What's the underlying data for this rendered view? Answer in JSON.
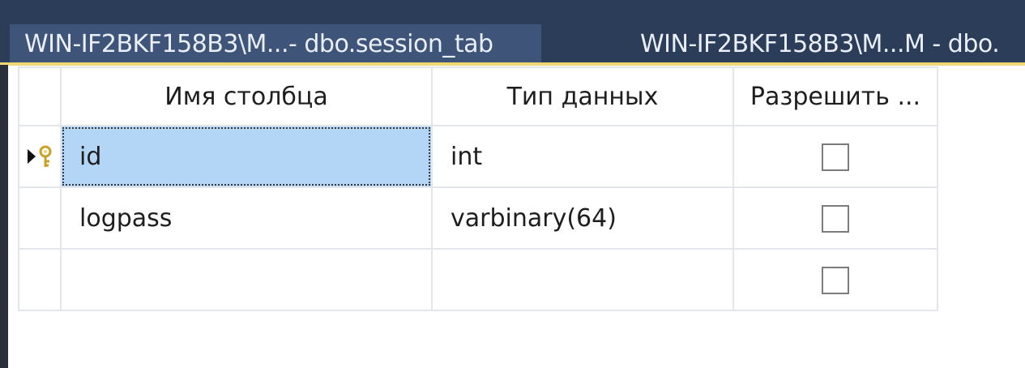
{
  "tabs": [
    {
      "label": "WIN-IF2BKF158B3\\M...- dbo.session_tab",
      "active": true
    },
    {
      "label": "WIN-IF2BKF158B3\\M...M - dbo.",
      "active": false
    }
  ],
  "grid": {
    "headers": {
      "name": "Имя столбца",
      "type": "Тип данных",
      "allow_nulls": "Разрешить ..."
    },
    "rows": [
      {
        "name": "id",
        "type": "int",
        "allow_nulls": false,
        "primary_key": true,
        "current": true
      },
      {
        "name": "logpass",
        "type": "varbinary(64)",
        "allow_nulls": false,
        "primary_key": false,
        "current": false
      },
      {
        "name": "",
        "type": "",
        "allow_nulls": false,
        "primary_key": false,
        "current": false
      }
    ]
  },
  "colors": {
    "tab_strip": "#2c3d5a",
    "active_tab": "#3e5478",
    "accent": "#f2d774",
    "selected_cell": "#b4d6f6",
    "pk_key": "#e0b93a"
  },
  "icons": {
    "current_row": "row-pointer-icon",
    "primary_key": "key-icon"
  }
}
